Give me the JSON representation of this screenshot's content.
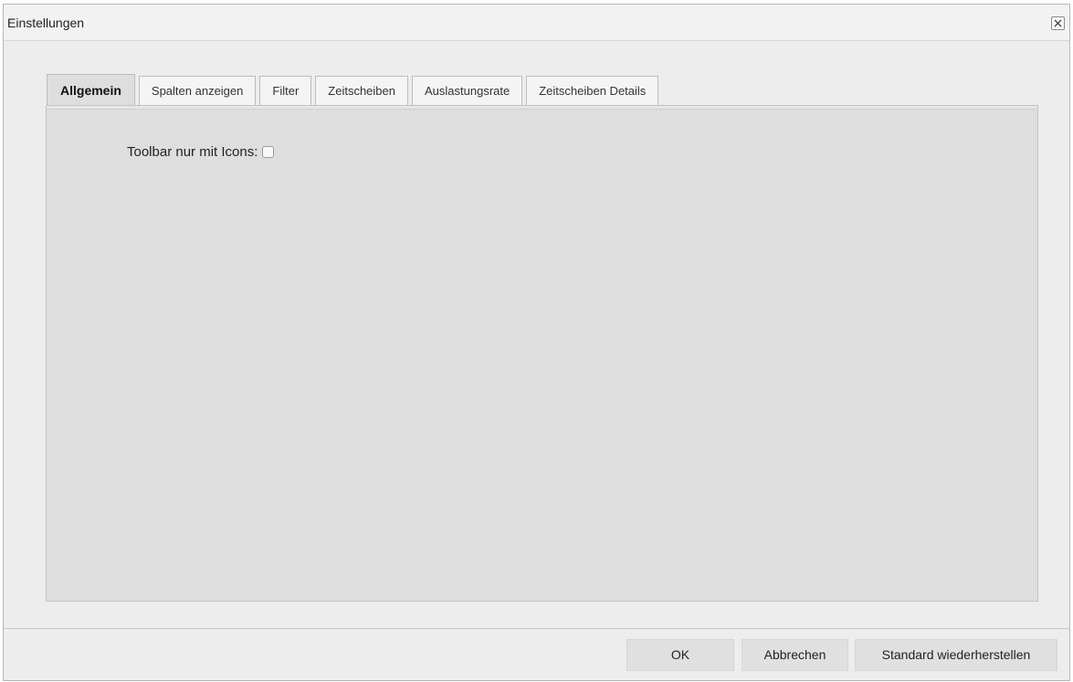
{
  "dialog": {
    "title": "Einstellungen"
  },
  "tabs": [
    {
      "label": "Allgemein",
      "active": true
    },
    {
      "label": "Spalten anzeigen",
      "active": false
    },
    {
      "label": "Filter",
      "active": false
    },
    {
      "label": "Zeitscheiben",
      "active": false
    },
    {
      "label": "Auslastungsrate",
      "active": false
    },
    {
      "label": "Zeitscheiben Details",
      "active": false
    }
  ],
  "general": {
    "toolbar_icons_label": "Toolbar nur mit Icons:",
    "toolbar_icons_checked": false
  },
  "footer": {
    "ok_label": "OK",
    "cancel_label": "Abbrechen",
    "restore_label": "Standard wiederherstellen"
  },
  "icons": {
    "close": "close-icon"
  }
}
